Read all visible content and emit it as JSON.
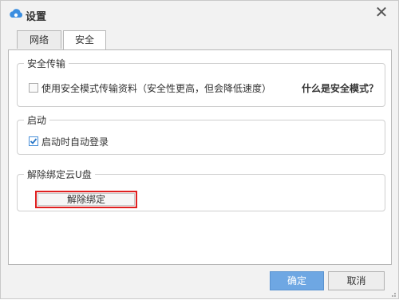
{
  "window": {
    "title": "设置",
    "app_icon": "cloud-icon",
    "close_glyph": "✕"
  },
  "tabs": [
    {
      "label": "网络",
      "selected": false
    },
    {
      "label": "安全",
      "selected": true
    }
  ],
  "secure_transfer": {
    "legend": "安全传输",
    "checkbox_label": "使用安全模式传输资料（安全性更高，但会降低速度）",
    "checked": false,
    "help_link": "什么是安全模式？"
  },
  "startup": {
    "legend": "启动",
    "checkbox_label": "启动时自动登录",
    "checked": true
  },
  "unbind": {
    "legend": "解除绑定云U盘",
    "button_label": "解除绑定",
    "highlight_color": "#e02020"
  },
  "footer": {
    "ok_label": "确定",
    "cancel_label": "取消"
  },
  "colors": {
    "accent": "#6ea7e3",
    "check": "#4a90d9"
  }
}
